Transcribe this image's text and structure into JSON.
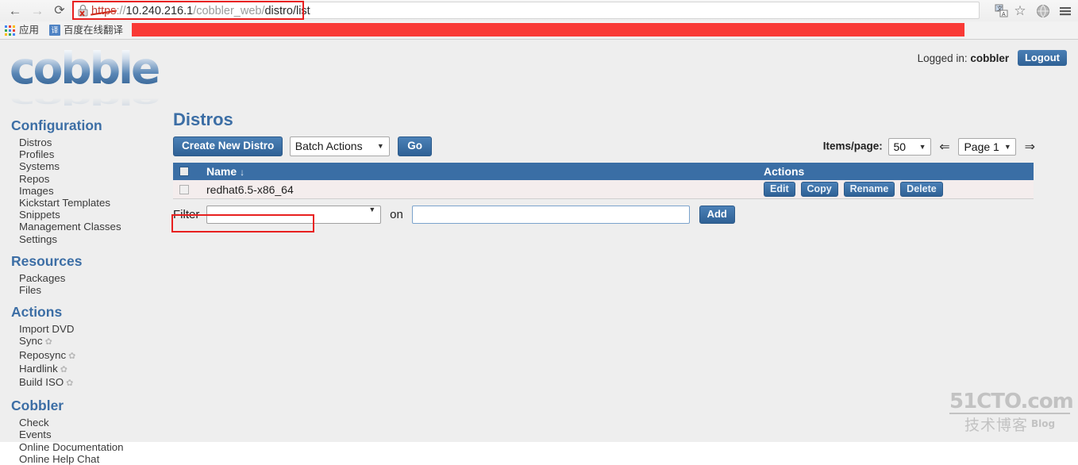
{
  "browser": {
    "nav": {
      "back_icon": "back-arrow-icon",
      "forward_icon": "forward-arrow-icon",
      "reload_icon": "reload-icon"
    },
    "url": {
      "scheme": "https",
      "separator": "://",
      "host": "10.240.216.1",
      "path": "/cobbler_web/",
      "path_tail": "distro/list",
      "security_icon": "broken-lock-icon"
    },
    "toolbar_icons": {
      "translate": "translate-page-icon",
      "star": "☆",
      "globe": "globe-icon",
      "menu": "hamburger-menu-icon"
    },
    "bookmarks": {
      "apps_label": "应用",
      "translate_glyph": "译",
      "translate_label": "百度在线翻译"
    }
  },
  "header": {
    "logo_text": "cobbler",
    "logged_in_prefix": "Logged in:",
    "username": "cobbler",
    "logout_label": "Logout"
  },
  "sidebar": {
    "groups": [
      {
        "title": "Configuration",
        "items": [
          {
            "label": "Distros",
            "gear": false
          },
          {
            "label": "Profiles",
            "gear": false
          },
          {
            "label": "Systems",
            "gear": false
          },
          {
            "label": "Repos",
            "gear": false
          },
          {
            "label": "Images",
            "gear": false
          },
          {
            "label": "Kickstart Templates",
            "gear": false
          },
          {
            "label": "Snippets",
            "gear": false
          },
          {
            "label": "Management Classes",
            "gear": false
          },
          {
            "label": "Settings",
            "gear": false
          }
        ]
      },
      {
        "title": "Resources",
        "items": [
          {
            "label": "Packages",
            "gear": false
          },
          {
            "label": "Files",
            "gear": false
          }
        ]
      },
      {
        "title": "Actions",
        "items": [
          {
            "label": "Import DVD",
            "gear": false
          },
          {
            "label": "Sync",
            "gear": true
          },
          {
            "label": "Reposync",
            "gear": true
          },
          {
            "label": "Hardlink",
            "gear": true
          },
          {
            "label": "Build ISO",
            "gear": true
          }
        ]
      },
      {
        "title": "Cobbler",
        "items": [
          {
            "label": "Check",
            "gear": false
          },
          {
            "label": "Events",
            "gear": false
          },
          {
            "label": "Online Documentation",
            "gear": false
          },
          {
            "label": "Online Help Chat",
            "gear": false
          }
        ]
      }
    ],
    "gear_glyph": "✿"
  },
  "main": {
    "page_title": "Distros",
    "toolbar": {
      "create_label": "Create New Distro",
      "batch_actions_value": "Batch Actions",
      "go_label": "Go"
    },
    "pager": {
      "items_per_page_label": "Items/page:",
      "items_per_page_value": "50",
      "prev_arrow": "⇐",
      "page_value": "Page 1",
      "next_arrow": "⇒"
    },
    "table": {
      "columns": [
        "",
        "Name",
        "Actions"
      ],
      "sort_arrow": "↓",
      "rows": [
        {
          "checked": false,
          "name": "redhat6.5-x86_64",
          "actions": [
            "Edit",
            "Copy",
            "Rename",
            "Delete"
          ]
        }
      ]
    },
    "filter": {
      "label": "Filter",
      "field_value": "",
      "on_label": "on",
      "value": "",
      "value_placeholder": "",
      "add_label": "Add"
    }
  },
  "watermark": {
    "top": "51CTO.com",
    "bottom": "技术博客",
    "blog": "Blog"
  },
  "colors": {
    "accent_blue": "#3a6ea5",
    "title_blue": "#3c6ea5",
    "annotation_red": "#e8201f",
    "redaction_red": "#f93a36",
    "page_bg": "#eeeeee",
    "row_bg": "#f4eded"
  }
}
